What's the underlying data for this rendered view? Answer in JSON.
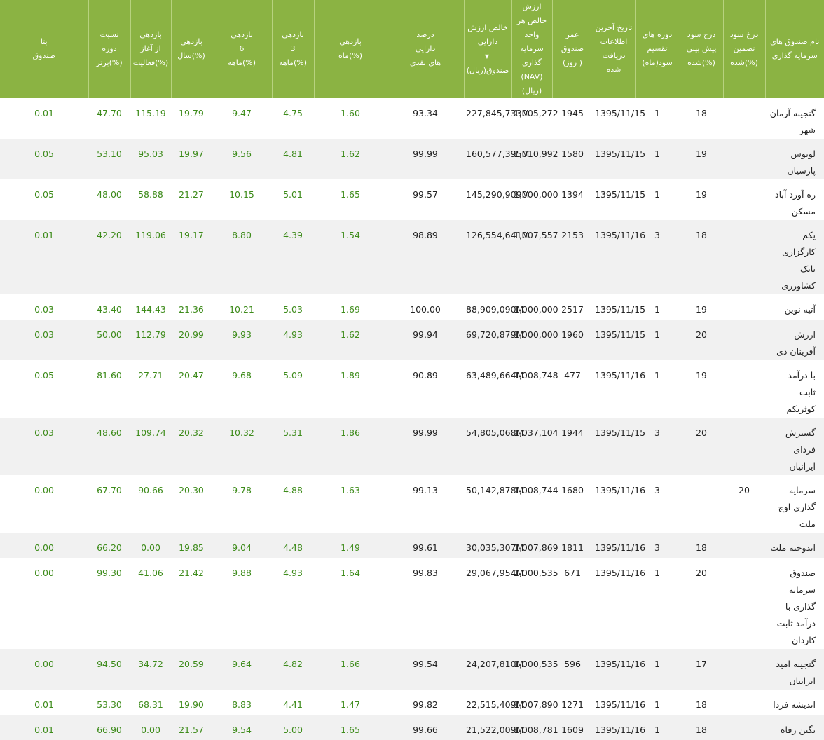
{
  "headers": [
    {
      "key": "name",
      "lines": [
        "نام صندوق های",
        "سرمایه گذاری"
      ]
    },
    {
      "key": "guaranteed",
      "lines": [
        "درخ سود",
        "تضمین",
        "شده(%)"
      ]
    },
    {
      "key": "forecast",
      "lines": [
        "درخ سود",
        "پیش بینی",
        "شده(%)"
      ]
    },
    {
      "key": "period",
      "lines": [
        "دوره های",
        "تقسیم",
        "سود(ماه)"
      ]
    },
    {
      "key": "date",
      "lines": [
        "تاریخ آخرین",
        "اطلاعات",
        "دریافت شده"
      ]
    },
    {
      "key": "age",
      "lines": [
        "عمر",
        "صندوق",
        "(روز )"
      ]
    },
    {
      "key": "nav",
      "lines": [
        "ارزش خالص هر",
        "واحد سرمایه گذاری",
        "(NAV)(ریال)"
      ]
    },
    {
      "key": "total",
      "lines": [
        "خالص ارزش",
        "دارایی",
        "صندوق(ریال)"
      ],
      "sort": "▼"
    },
    {
      "key": "cash",
      "lines": [
        "درصد",
        "دارایی",
        "های نقدی"
      ]
    },
    {
      "key": "m1",
      "lines": [
        "بازدهی",
        "ماه(%)"
      ]
    },
    {
      "key": "m3",
      "lines": [
        "بازدهی",
        "3",
        "ماهه(%)"
      ]
    },
    {
      "key": "m6",
      "lines": [
        "بازدهی",
        "6",
        "ماهه(%)"
      ]
    },
    {
      "key": "y1",
      "lines": [
        "بازدهی",
        "سال(%)"
      ]
    },
    {
      "key": "start",
      "lines": [
        "بازدهی",
        "از آغاز",
        "فعالیت(%)"
      ]
    },
    {
      "key": "rank",
      "lines": [
        "نسبت",
        "دوره",
        "برتر(%)"
      ]
    },
    {
      "key": "beta",
      "lines": [
        "بتا",
        "صندوق"
      ]
    }
  ],
  "rows": [
    {
      "name": [
        "گنجینه آرمان شهر"
      ],
      "guaranteed": "",
      "forecast": "18",
      "period": "1",
      "date": "1395/11/15",
      "age": "1945",
      "nav": "1,005,272",
      "total": "227,845,733M",
      "cash": "93.34",
      "m1": "1.60",
      "m3": "4.75",
      "m6": "9.47",
      "y1": "19.79",
      "start": "115.19",
      "rank": "47.70",
      "beta": "0.01"
    },
    {
      "name": [
        "لوتوس پارسیان"
      ],
      "guaranteed": "",
      "forecast": "19",
      "period": "1",
      "date": "1395/11/15",
      "age": "1580",
      "nav": "1,010,992",
      "total": "160,577,395M",
      "cash": "99.99",
      "m1": "1.62",
      "m3": "4.81",
      "m6": "9.56",
      "y1": "19.97",
      "start": "95.03",
      "rank": "53.10",
      "beta": "0.05"
    },
    {
      "name": [
        "ره آورد آباد مسکن"
      ],
      "guaranteed": "",
      "forecast": "19",
      "period": "1",
      "date": "1395/11/15",
      "age": "1394",
      "nav": "1,000,000",
      "total": "145,290,909M",
      "cash": "99.57",
      "m1": "1.65",
      "m3": "5.01",
      "m6": "10.15",
      "y1": "21.27",
      "start": "58.88",
      "rank": "48.00",
      "beta": "0.05"
    },
    {
      "name": [
        "یکم کارگزاری بانک",
        "کشاورزی"
      ],
      "guaranteed": "",
      "forecast": "18",
      "period": "3",
      "date": "1395/11/16",
      "age": "2153",
      "nav": "1,007,557",
      "total": "126,554,641M",
      "cash": "98.89",
      "m1": "1.54",
      "m3": "4.39",
      "m6": "8.80",
      "y1": "19.17",
      "start": "119.06",
      "rank": "42.20",
      "beta": "0.01"
    },
    {
      "name": [
        "آتیه نوین"
      ],
      "guaranteed": "",
      "forecast": "19",
      "period": "1",
      "date": "1395/11/15",
      "age": "2517",
      "nav": "1,000,000",
      "total": "88,909,090M",
      "cash": "100.00",
      "m1": "1.69",
      "m3": "5.03",
      "m6": "10.21",
      "y1": "21.36",
      "start": "144.43",
      "rank": "43.40",
      "beta": "0.03"
    },
    {
      "name": [
        "ارزش آفرینان دی"
      ],
      "guaranteed": "",
      "forecast": "20",
      "period": "1",
      "date": "1395/11/15",
      "age": "1960",
      "nav": "1,000,000",
      "total": "69,720,879M",
      "cash": "99.94",
      "m1": "1.62",
      "m3": "4.93",
      "m6": "9.93",
      "y1": "20.99",
      "start": "112.79",
      "rank": "50.00",
      "beta": "0.03"
    },
    {
      "name": [
        "با درآمد ثابت",
        "کوثریکم"
      ],
      "guaranteed": "",
      "forecast": "19",
      "period": "1",
      "date": "1395/11/16",
      "age": "477",
      "nav": "1,008,748",
      "total": "63,489,664M",
      "cash": "90.89",
      "m1": "1.89",
      "m3": "5.09",
      "m6": "9.68",
      "y1": "20.47",
      "start": "27.71",
      "rank": "81.60",
      "beta": "0.05"
    },
    {
      "name": [
        "گسترش فردای",
        "ایرانیان"
      ],
      "guaranteed": "",
      "forecast": "20",
      "period": "3",
      "date": "1395/11/15",
      "age": "1944",
      "nav": "1,037,104",
      "total": "54,805,068M",
      "cash": "99.99",
      "m1": "1.86",
      "m3": "5.31",
      "m6": "10.32",
      "y1": "20.32",
      "start": "109.74",
      "rank": "48.60",
      "beta": "0.03"
    },
    {
      "name": [
        "سرمایه گذاری اوج",
        "ملت"
      ],
      "guaranteed": "20",
      "forecast": "",
      "period": "3",
      "date": "1395/11/16",
      "age": "1680",
      "nav": "1,008,744",
      "total": "50,142,878M",
      "cash": "99.13",
      "m1": "1.63",
      "m3": "4.88",
      "m6": "9.78",
      "y1": "20.30",
      "start": "90.66",
      "rank": "67.70",
      "beta": "0.00"
    },
    {
      "name": [
        "اندوخته ملت"
      ],
      "guaranteed": "",
      "forecast": "18",
      "period": "3",
      "date": "1395/11/16",
      "age": "1811",
      "nav": "1,007,869",
      "total": "30,035,307M",
      "cash": "99.61",
      "m1": "1.49",
      "m3": "4.48",
      "m6": "9.04",
      "y1": "19.85",
      "start": "0.00",
      "rank": "66.20",
      "beta": "0.00"
    },
    {
      "name": [
        "صندوق سرمایه",
        "گذاری با درآمد ثابت",
        "کاردان"
      ],
      "guaranteed": "",
      "forecast": "20",
      "period": "1",
      "date": "1395/11/16",
      "age": "671",
      "nav": "1,000,535",
      "total": "29,067,954M",
      "cash": "99.83",
      "m1": "1.64",
      "m3": "4.93",
      "m6": "9.88",
      "y1": "21.42",
      "start": "41.06",
      "rank": "99.30",
      "beta": "0.00"
    },
    {
      "name": [
        "گنجینه امید ایرانیان"
      ],
      "guaranteed": "",
      "forecast": "17",
      "period": "1",
      "date": "1395/11/16",
      "age": "596",
      "nav": "1,000,535",
      "total": "24,207,810M",
      "cash": "99.54",
      "m1": "1.66",
      "m3": "4.82",
      "m6": "9.64",
      "y1": "20.59",
      "start": "34.72",
      "rank": "94.50",
      "beta": "0.00"
    },
    {
      "name": [
        "اندیشه فردا"
      ],
      "guaranteed": "",
      "forecast": "18",
      "period": "1",
      "date": "1395/11/16",
      "age": "1271",
      "nav": "1,007,890",
      "total": "22,515,409M",
      "cash": "99.82",
      "m1": "1.47",
      "m3": "4.41",
      "m6": "8.83",
      "y1": "19.90",
      "start": "68.31",
      "rank": "53.30",
      "beta": "0.01"
    },
    {
      "name": [
        "نگین رفاه"
      ],
      "guaranteed": "",
      "forecast": "18",
      "period": "1",
      "date": "1395/11/16",
      "age": "1609",
      "nav": "1,008,781",
      "total": "21,522,009M",
      "cash": "99.66",
      "m1": "1.65",
      "m3": "5.00",
      "m6": "9.54",
      "y1": "21.57",
      "start": "0.00",
      "rank": "66.90",
      "beta": "0.01"
    }
  ],
  "colors": {
    "header_bg": "#8bb343",
    "header_text": "#ffffff",
    "green_text": "#3d8b1a",
    "alt_row": "#f1f1f1"
  }
}
